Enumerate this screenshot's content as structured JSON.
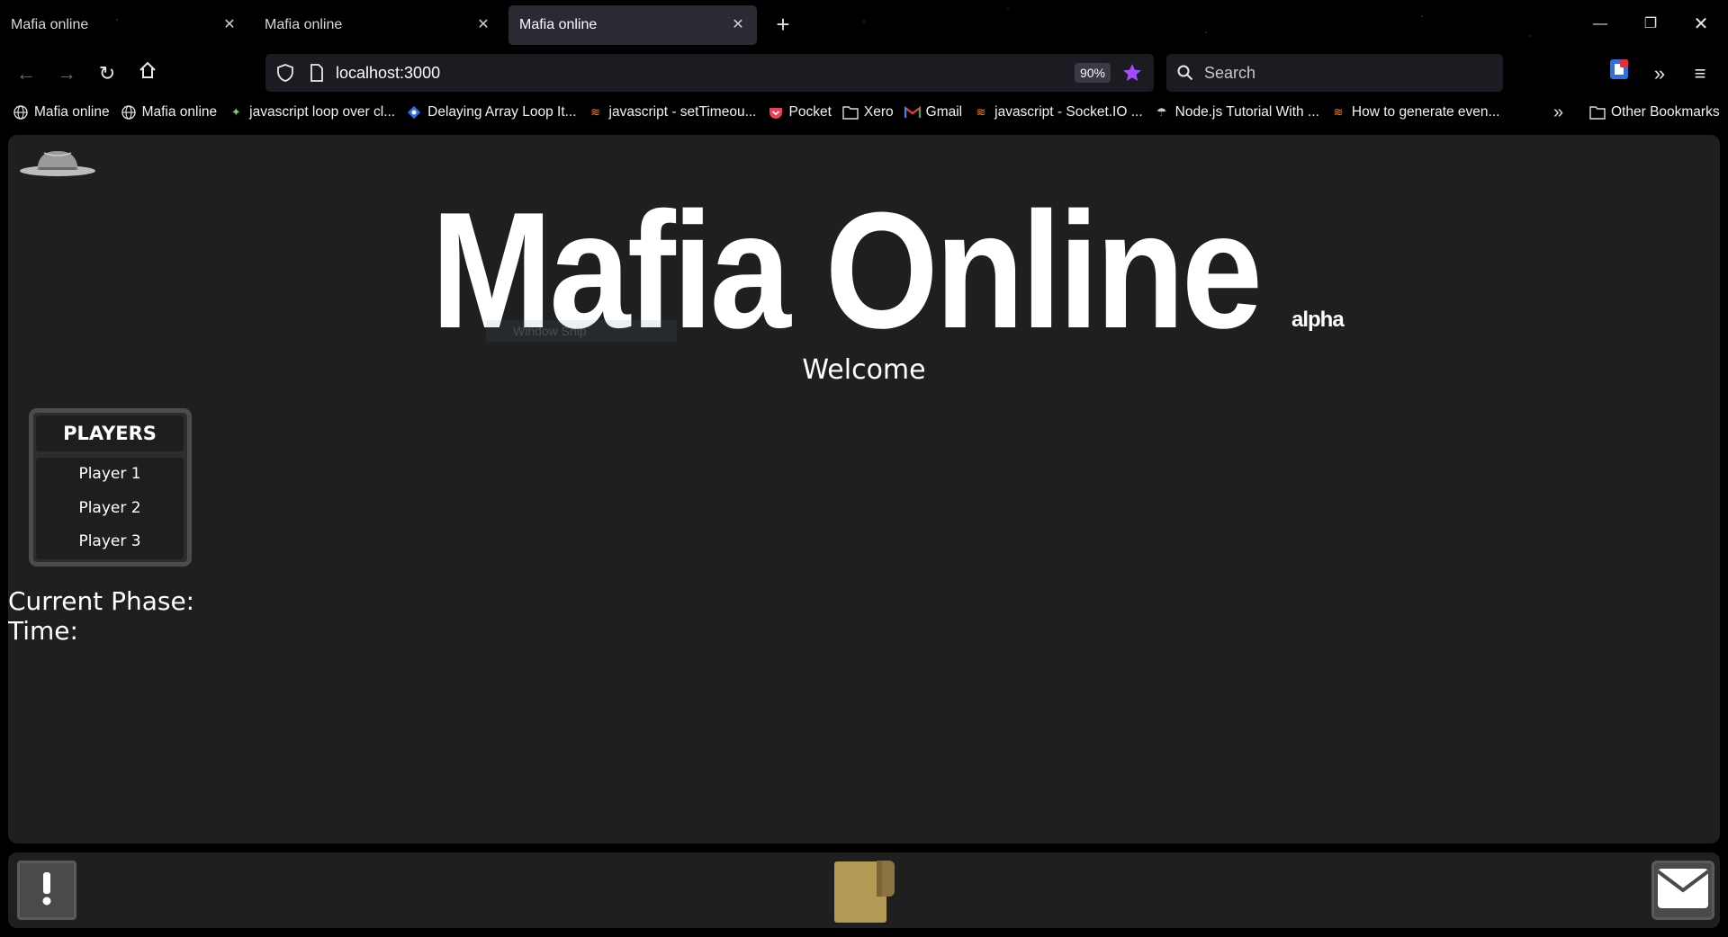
{
  "browser": {
    "tabs": [
      {
        "title": "Mafia online",
        "active": false
      },
      {
        "title": "Mafia online",
        "active": false
      },
      {
        "title": "Mafia online",
        "active": true
      }
    ],
    "new_tab_icon": "plus-icon",
    "url": "localhost:3000",
    "zoom": "90%",
    "search_placeholder": "Search",
    "bookmarks": [
      {
        "label": "Mafia online",
        "icon": "globe-icon"
      },
      {
        "label": "Mafia online",
        "icon": "globe-icon"
      },
      {
        "label": "javascript loop over cl...",
        "icon": "sparkle-icon"
      },
      {
        "label": "Delaying Array Loop It...",
        "icon": "blue-diamond-icon"
      },
      {
        "label": "javascript - setTimeou...",
        "icon": "stackoverflow-icon"
      },
      {
        "label": "Pocket",
        "icon": "pocket-icon"
      },
      {
        "label": "Xero",
        "icon": "folder-icon"
      },
      {
        "label": "Gmail",
        "icon": "gmail-icon"
      },
      {
        "label": "javascript - Socket.IO ...",
        "icon": "stackoverflow-icon"
      },
      {
        "label": "Node.js Tutorial With ...",
        "icon": "site-icon"
      },
      {
        "label": "How to generate even...",
        "icon": "stackoverflow-icon"
      }
    ],
    "other_bookmarks": "Other Bookmarks",
    "colors": {
      "chrome_bg": "#000000",
      "urlbar_bg": "#1c1b22",
      "star": "#a34bff"
    }
  },
  "page": {
    "title": "Mafia Online",
    "badge": "alpha",
    "welcome": "Welcome",
    "snip_overlay": "Window Snip",
    "players": {
      "header": "PLAYERS",
      "items": [
        "Player 1",
        "Player 2",
        "Player 3"
      ]
    },
    "phase_label": "Current Phase:",
    "time_label": "Time:",
    "colors": {
      "page_bg": "#1f1f1f",
      "panel_border": "#4c4c4c",
      "book": "#b59a55"
    }
  }
}
